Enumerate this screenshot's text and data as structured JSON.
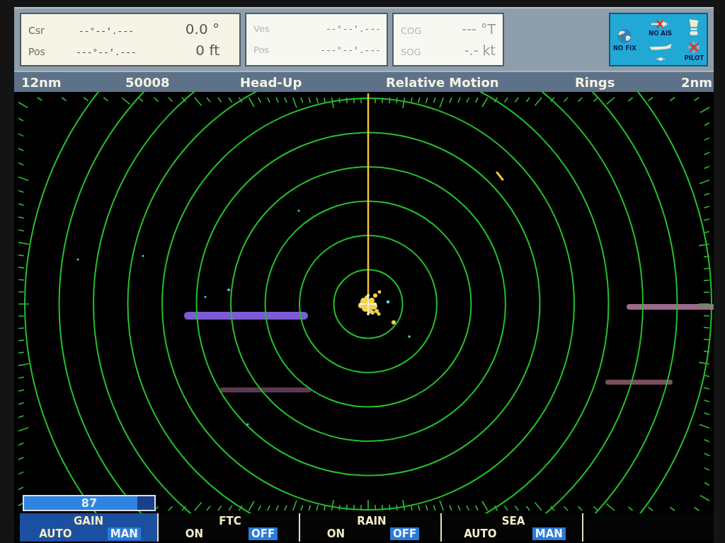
{
  "readouts": [
    {
      "dimmed": false,
      "rows": [
        {
          "label": "Csr",
          "position": "--°--'.---",
          "value": "0.0 °"
        },
        {
          "label": "Pos",
          "position": "---°--'.---",
          "value": "0 ft"
        }
      ]
    },
    {
      "dimmed": true,
      "rows": [
        {
          "label": "Ves",
          "position": "--°--'.---"
        },
        {
          "label": "Pos",
          "position": "---°--'.---"
        }
      ]
    },
    {
      "dimmed": true,
      "rows": [
        {
          "label": "COG",
          "value": "--- °T"
        },
        {
          "label": "SOG",
          "value": "-.- kt"
        }
      ]
    }
  ],
  "status_icons": [
    {
      "kind": "fix",
      "label": "NO FIX"
    },
    {
      "kind": "ais",
      "label": "NO AIS"
    },
    {
      "kind": "pilot",
      "label": "PILOT"
    }
  ],
  "status_bar": [
    "12nm",
    "50008",
    "Head-Up",
    "Relative Motion",
    "Rings",
    "2nm"
  ],
  "gain_bar": {
    "level": 0.87,
    "reading": "87"
  },
  "controls": [
    {
      "name": "GAIN",
      "selected": true,
      "options": [
        {
          "label": "AUTO",
          "selected": false
        },
        {
          "label": "MAN",
          "selected": true
        }
      ]
    },
    {
      "name": "FTC",
      "selected": false,
      "options": [
        {
          "label": "ON",
          "selected": false
        },
        {
          "label": "OFF",
          "selected": true
        }
      ]
    },
    {
      "name": "RAIN",
      "selected": false,
      "options": [
        {
          "label": "ON",
          "selected": false
        },
        {
          "label": "OFF",
          "selected": true
        }
      ]
    },
    {
      "name": "SEA",
      "selected": false,
      "options": [
        {
          "label": "AUTO",
          "selected": false
        },
        {
          "label": "MAN",
          "selected": true
        }
      ]
    }
  ]
}
